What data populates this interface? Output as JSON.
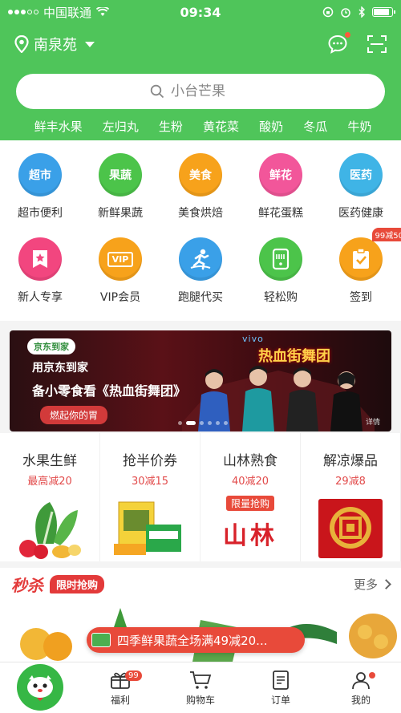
{
  "status": {
    "carrier": "中国联通",
    "time": "09:34"
  },
  "header": {
    "location": "南泉苑",
    "search_placeholder": "小台芒果",
    "hotwords": [
      "鲜丰水果",
      "左归丸",
      "生粉",
      "黄花菜",
      "酸奶",
      "冬瓜",
      "牛奶"
    ]
  },
  "categories": {
    "row1": [
      {
        "icon_text": "超市",
        "label": "超市便利",
        "color": "#3aa0e8"
      },
      {
        "icon_text": "果蔬",
        "label": "新鲜果蔬",
        "color": "#4cc44a"
      },
      {
        "icon_text": "美食",
        "label": "美食烘焙",
        "color": "#f7a21b"
      },
      {
        "icon_text": "鲜花",
        "label": "鲜花蛋糕",
        "color": "#f2569a"
      },
      {
        "icon_text": "医药",
        "label": "医药健康",
        "color": "#3fb4e6"
      }
    ],
    "row2": [
      {
        "icon_name": "star-ribbon-icon",
        "label": "新人专享",
        "color": "#f2467f"
      },
      {
        "icon_text": "VIP",
        "label": "VIP会员",
        "color": "#f7a21b"
      },
      {
        "icon_name": "runner-icon",
        "label": "跑腿代买",
        "color": "#3aa0e8"
      },
      {
        "icon_name": "scanner-icon",
        "label": "轻松购",
        "color": "#4cc44a"
      },
      {
        "icon_name": "checklist-icon",
        "label": "签到",
        "color": "#f7a21b",
        "badge": "99减50"
      }
    ]
  },
  "banner": {
    "brand": "京东到家",
    "line1": "用京东到家",
    "line2": "备小零食看《热血街舞团》",
    "cta": "燃起你的胃",
    "sponsor": "vivo",
    "show_title": "热血街舞团",
    "detail": "详情"
  },
  "deals": [
    {
      "title": "水果生鲜",
      "sub": "最高减20"
    },
    {
      "title": "抢半价券",
      "sub": "30减15"
    },
    {
      "title": "山林熟食",
      "sub": "40减20",
      "tag": "限量抢购",
      "brand": "山林"
    },
    {
      "title": "解凉爆品",
      "sub": "29减8"
    }
  ],
  "seckill": {
    "logo": "秒杀",
    "tag": "限时抢购",
    "more": "更多"
  },
  "promo": "四季鲜果蔬全场满49减20...",
  "tabbar": [
    {
      "label": "",
      "icon": "home-mascot-icon"
    },
    {
      "label": "福利",
      "icon": "gift-icon",
      "badge": "99"
    },
    {
      "label": "购物车",
      "icon": "cart-icon"
    },
    {
      "label": "订单",
      "icon": "order-icon"
    },
    {
      "label": "我的",
      "icon": "profile-icon"
    }
  ]
}
